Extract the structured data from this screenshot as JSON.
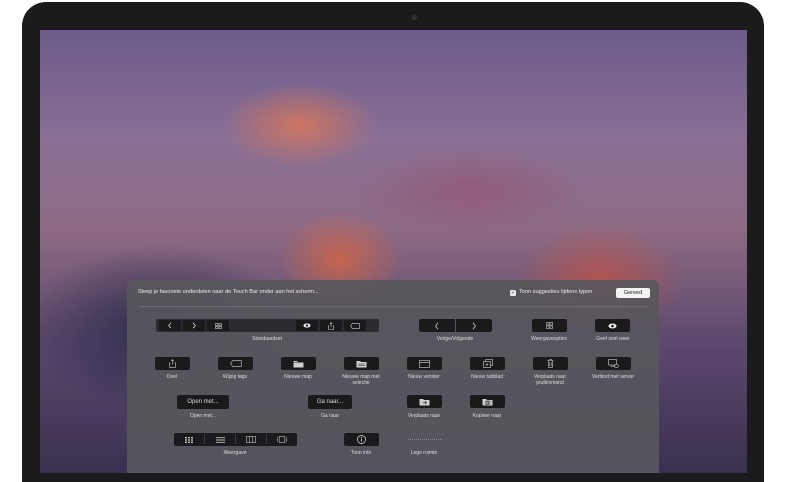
{
  "panel": {
    "title": "Sleep je favoriete onderdelen naar de Touch Bar onder aan het scherm...",
    "suggestions_label": "Toon suggesties tijdens typen",
    "suggestions_checked": true,
    "done_label": "Gereed"
  },
  "items": {
    "standaardset": "Standaardset",
    "vorige_volgende": "Vorige/Volgende",
    "weergaveopties": "Weergaveopties",
    "geef_snel_weer": "Geef snel weer",
    "deel": "Deel",
    "wijzig_tags": "Wijzig tags",
    "nieuwe_map": "Nieuwe map",
    "nieuwe_map_met_selectie_1": "Nieuwe map met",
    "nieuwe_map_met_selectie_2": "selectie",
    "nieuw_venster": "Nieuw venster",
    "nieuw_tabblad": "Nieuw tabblad",
    "verplaats_prullenmand_1": "Verplaats naar",
    "verplaats_prullenmand_2": "prullenmand",
    "verbind_met_server": "Verbind met server",
    "open_met_button": "Open met...",
    "open_met": "Open met...",
    "ga_naar_button": "Ga naar...",
    "ga_naar": "Ga naar",
    "verplaats_naar": "Verplaats naar",
    "kopieer_naar": "Kopieer naar",
    "weergave": "Weergave",
    "toon_info": "Toon info",
    "lege_ruimte": "Lege ruimte"
  },
  "icons": {
    "standaardset": [
      "chevron-left-icon",
      "chevron-right-icon",
      "view-options-icon",
      "eye-icon",
      "share-icon",
      "tag-icon"
    ],
    "vorige_volgende": [
      "chevron-left-icon",
      "chevron-right-icon"
    ],
    "weergave": [
      "icon-view-icon",
      "list-view-icon",
      "column-view-icon",
      "gallery-view-icon"
    ]
  },
  "colors": {
    "panel_bg": "#58565c",
    "button_bg": "#1a1a1c",
    "done_bg": "#f2f2f2"
  }
}
